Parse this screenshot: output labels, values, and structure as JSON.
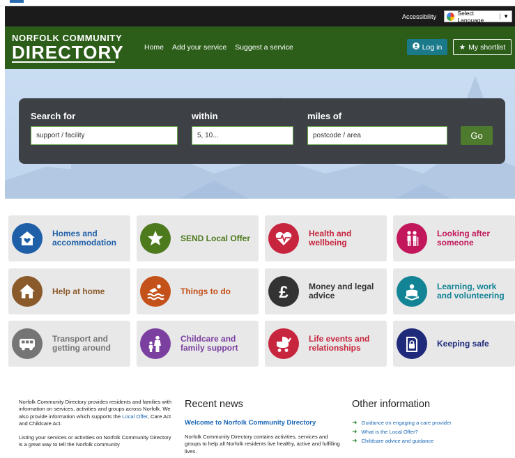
{
  "utility": {
    "accessibility": "Accessibility",
    "language": "Select Language"
  },
  "header": {
    "logo_line1": "NORFOLK COMMUNITY",
    "logo_line2": "DIRECTORY",
    "nav": [
      "Home",
      "Add your service",
      "Suggest a service"
    ],
    "login": "Log in",
    "shortlist": "My shortlist"
  },
  "search": {
    "label_search": "Search for",
    "label_within": "within",
    "label_miles": "miles of",
    "search_placeholder": "support / facility",
    "within_placeholder": "5, 10...",
    "location_placeholder": "postcode / area",
    "go": "Go"
  },
  "categories": [
    {
      "label": "Homes and accommodation",
      "icon": "house-heart-icon",
      "color": "#1f5fa8",
      "text_color": "#1f5fa8"
    },
    {
      "label": "SEND Local Offer",
      "icon": "star-icon",
      "color": "#4e7a1e",
      "text_color": "#4e7a1e"
    },
    {
      "label": "Health and wellbeing",
      "icon": "heart-pulse-icon",
      "color": "#c7253e",
      "text_color": "#c7253e"
    },
    {
      "label": "Looking after someone",
      "icon": "carer-icon",
      "color": "#c2185b",
      "text_color": "#c2185b"
    },
    {
      "label": "Help at home",
      "icon": "home-icon",
      "color": "#8b5a2b",
      "text_color": "#8b5a2b"
    },
    {
      "label": "Things to do",
      "icon": "swimmer-icon",
      "color": "#c4511a",
      "text_color": "#c4511a"
    },
    {
      "label": "Money and legal advice",
      "icon": "pound-icon",
      "color": "#333333",
      "text_color": "#333333"
    },
    {
      "label": "Learning, work and volunteering",
      "icon": "reading-icon",
      "color": "#138496",
      "text_color": "#138496"
    },
    {
      "label": "Transport and getting around",
      "icon": "bus-icon",
      "color": "#757575",
      "text_color": "#757575"
    },
    {
      "label": "Childcare and family support",
      "icon": "family-icon",
      "color": "#7b3fa0",
      "text_color": "#7b3fa0"
    },
    {
      "label": "Life events and relationships",
      "icon": "pram-icon",
      "color": "#c7253e",
      "text_color": "#c7253e"
    },
    {
      "label": "Keeping safe",
      "icon": "lock-icon",
      "color": "#1f2a7a",
      "text_color": "#1f2a7a"
    }
  ],
  "intro": {
    "p1_a": "Norfolk Community Directory provides residents and families with information on services, activities and groups across Norfolk. We also provide information which supports the ",
    "p1_link": "Local Offer",
    "p1_b": ", Care Act and Childcare Act.",
    "p2": "Listing your services or activities on Norfolk Community Directory is a great way to tell the Norfolk community"
  },
  "news": {
    "title": "Recent news",
    "item_title": "Welcome to Norfolk Community Directory",
    "item_body": "Norfolk Community Directory contains activities, services and groups to help all Norfolk residents live healthy, active and fulfilling lives."
  },
  "other": {
    "title": "Other information",
    "links": [
      "Guidance on engaging a care provider",
      "What is the Local Offer?",
      "Childcare advice and guidance"
    ]
  }
}
